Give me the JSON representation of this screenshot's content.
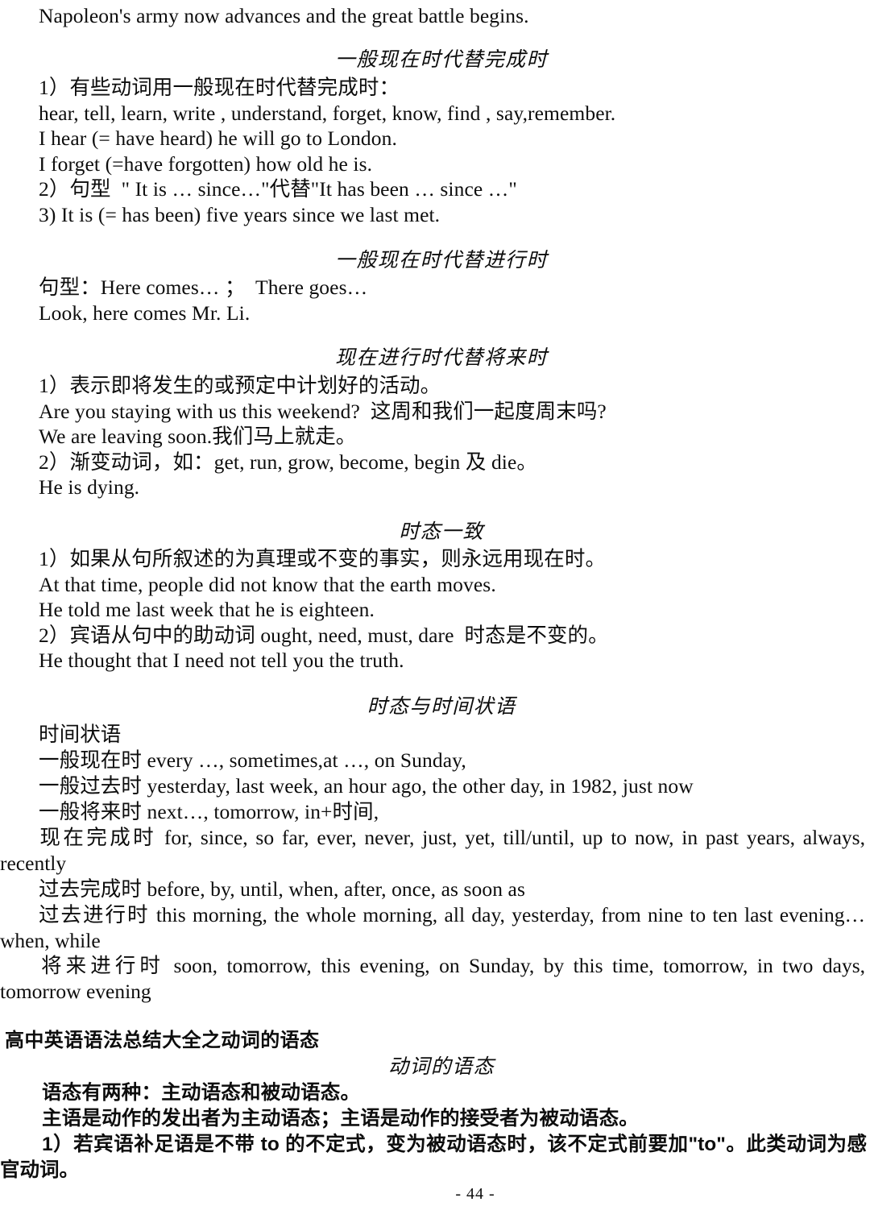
{
  "document": {
    "page_number_label": "- 44 -"
  },
  "intro": {
    "line": "Napoleon's army now advances and the great battle begins."
  },
  "sections": [
    {
      "heading": "一般现在时代替完成时",
      "lines": [
        "1）有些动词用一般现在时代替完成时：",
        "hear, tell, learn, write , understand, forget, know, find , say,remember.",
        "I hear (= have heard) he will go to London.",
        "I forget (=have forgotten) how old he is.",
        "2）句型  \" It is … since…\"代替\"It has been … since …\"",
        "3) It is (= has been) five years since we last met."
      ]
    },
    {
      "heading": "一般现在时代替进行时",
      "lines": [
        "句型：Here comes… ；  There goes…",
        "Look, here comes Mr. Li."
      ]
    },
    {
      "heading": "现在进行时代替将来时",
      "lines": [
        "1）表示即将发生的或预定中计划好的活动。",
        "Are you staying with us this weekend?  这周和我们一起度周末吗?",
        "We are leaving soon.我们马上就走。",
        "2）渐变动词，如：get, run, grow, become, begin 及 die。",
        "He is dying."
      ]
    },
    {
      "heading": "时态一致",
      "lines": [
        "1）如果从句所叙述的为真理或不变的事实，则永远用现在时。",
        "At that time, people did not know that the earth moves.",
        "He told me last week that he is eighteen.",
        "2）宾语从句中的助动词 ought, need, must, dare  时态是不变的。",
        "He thought that I need not tell you the truth."
      ]
    }
  ],
  "tense_adverbials": {
    "heading": "时态与时间状语",
    "label": "时间状语",
    "rows": [
      {
        "tense": "一般现在时",
        "adverbials": "every …, sometimes,at …, on Sunday,",
        "justified": false
      },
      {
        "tense": "一般过去时",
        "adverbials": "yesterday, last week, an hour ago, the other day, in 1982, just now",
        "justified": false
      },
      {
        "tense": "一般将来时",
        "adverbials": "next…, tomorrow, in+时间,",
        "justified": false
      },
      {
        "tense": "现在完成时",
        "adverbials": "for, since, so far, ever, never, just, yet, till/until, up to now, in past years, always, recently",
        "justified": true
      },
      {
        "tense": "过去完成时",
        "adverbials": "before, by, until, when, after, once, as soon as",
        "justified": false
      },
      {
        "tense": "过去进行时",
        "adverbials": "this morning, the whole morning, all day, yesterday, from nine to ten last evening… when, while",
        "justified": true
      },
      {
        "tense": "将来进行时",
        "adverbials": "soon, tomorrow, this evening, on Sunday, by this time, tomorrow, in two days, tomorrow evening",
        "justified": true
      }
    ]
  },
  "voice_section": {
    "title": "高中英语语法总结大全之动词的语态",
    "heading": "动词的语态",
    "lines": [
      "语态有两种：主动语态和被动语态。",
      "主语是动作的发出者为主动语态；主语是动作的接受者为被动语态。"
    ],
    "justified_item": "1）若宾语补足语是不带 to 的不定式，变为被动语态时，该不定式前要加\"to\"。此类动词为感官动词。"
  }
}
